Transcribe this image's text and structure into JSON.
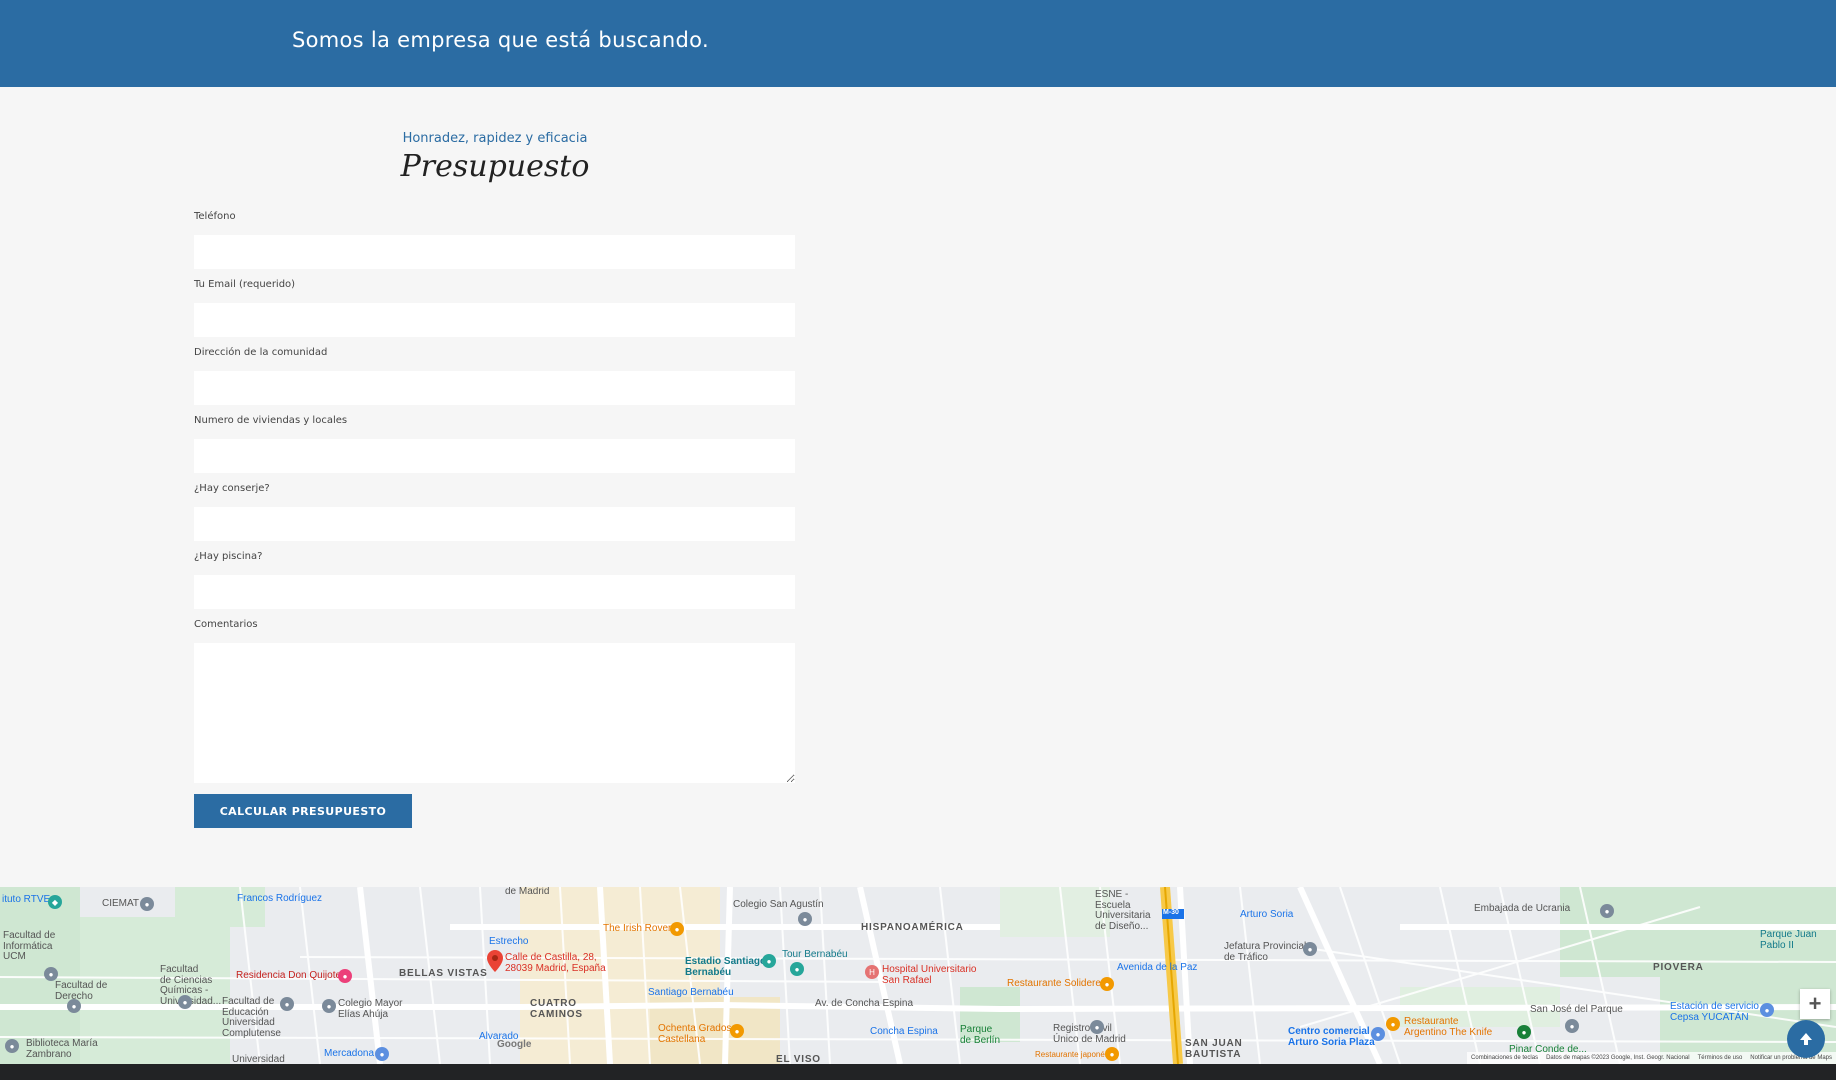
{
  "banner": {
    "tagline": "Somos la empresa que está buscando."
  },
  "form": {
    "subtitle": "Honradez, rapidez y eficacia",
    "title": "Presupuesto",
    "fields": [
      {
        "label": "Teléfono"
      },
      {
        "label": "Tu Email (requerido)"
      },
      {
        "label": "Dirección de la comunidad"
      },
      {
        "label": "Numero de viviendas y locales"
      },
      {
        "label": "¿Hay conserje?"
      },
      {
        "label": "¿Hay piscina?"
      },
      {
        "label": "Comentarios"
      }
    ],
    "submit_label": "CALCULAR PRESUPUESTO"
  },
  "map": {
    "marker_address": "Calle de Castilla, 28,\n28039 Madrid, España",
    "labels": {
      "ciemat": "CIEMAT",
      "rtve": "ituto RTVE",
      "francos": "Francos Rodríguez",
      "fac_inf": "Facultad de\nInformática\nUCM",
      "fac_quim": "Facultad\nde Ciencias\nQuímicas -\nUniversidad...",
      "fac_der": "Facultad de\nDerecho",
      "fac_edu": "Facultad de\nEducación\nUniversidad\nComplutense",
      "residencia": "Residencia Don Quijote",
      "colegio_mayor": "Colegio Mayor\nElías Ahúja",
      "biblioteca": "Biblioteca María\nZambrano",
      "universidad": "Universidad",
      "mercadona": "Mercadona",
      "bellas_vistas": "BELLAS VISTAS",
      "cuatro_caminos": "CUATRO\nCAMINOS",
      "estrecho": "Estrecho",
      "alvarado": "Alvarado",
      "irish_rover": "The Irish Rover",
      "colegio_san_agustin": "Colegio San Agustín",
      "estadio": "Estadio Santiago\nBernabéu",
      "tour_bernabeu": "Tour Bernabéu",
      "santiago_bernabeu": "Santiago Bernabéu",
      "ochenta": "Ochenta Grados\nCastellana",
      "hispanoamerica": "HISPANOAMÉRICA",
      "hospital": "Hospital Universitario\nSan Rafael",
      "concha_espina": "Concha Espina",
      "av_concha_espina": "Av. de Concha Espina",
      "parque_berlin": "Parque\nde Berlín",
      "el_viso": "EL VISO",
      "esne": "ESNE -\nEscuela\nUniversitaria\nde Diseño...",
      "solidere": "Restaurante Solidere",
      "registro_civil": "Registro Civil\nÚnico de Madrid",
      "rest_japones": "Restaurante japonés",
      "avenida_paz": "Avenida de la Paz",
      "arturo_soria": "Arturo Soria",
      "jefatura": "Jefatura Provincial\nde Tráfico",
      "san_juan": "SAN JUAN\nBAUTISTA",
      "centro_comercial": "Centro comercial\nArturo Soria Plaza",
      "embajada": "Embajada de Ucrania",
      "parque_juan_pablo": "Parque Juan\nPablo II",
      "piovera": "PIOVERA",
      "san_jose_parque": "San José del Parque",
      "estacion_servicio": "Estación de servicio\nCepsa YUCATÁN",
      "rest_argentino": "Restaurante\nArgentino The Knife",
      "pinar": "Pinar Conde de...",
      "m30": "M-30",
      "google": "Google",
      "de_madrid": "de Madrid"
    },
    "footer": {
      "shortcuts": "Combinaciones de teclas",
      "data": "Datos de mapas ©2023 Google, Inst. Geogr. Nacional",
      "terms": "Términos de uso",
      "report": "Notificar un problema de Maps"
    },
    "zoom_in_symbol": "+"
  },
  "icons": {
    "scroll_top": "arrow-up-icon",
    "marker": "map-pin-icon"
  },
  "colors": {
    "brand": "#2b6ca3",
    "background": "#f6f6f6",
    "footer": "#222325"
  }
}
